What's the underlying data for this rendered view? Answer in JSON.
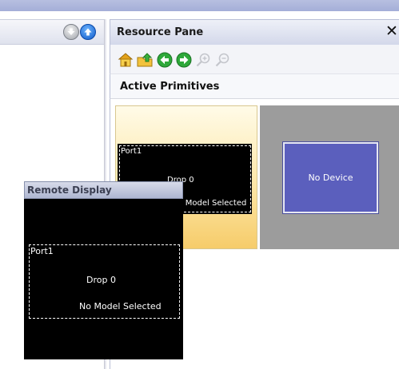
{
  "resource_pane": {
    "title": "Resource Pane",
    "close_glyph": "✕",
    "subtitle": "Active Primitives",
    "toolbar_icons": [
      "home-folder-icon",
      "up-folder-icon",
      "back-arrow-icon",
      "forward-arrow-icon",
      "zoom-in-icon",
      "zoom-out-icon"
    ],
    "tiles": [
      {
        "port_label": "Port1",
        "drop_label": "Drop 0",
        "model_label": "No Model Selected",
        "selected": true
      },
      {
        "device_label": "No Device",
        "selected": false
      }
    ]
  },
  "left_panel": {
    "icons": [
      "scroll-down-icon",
      "scroll-up-icon"
    ]
  },
  "remote_display": {
    "title": "Remote Display",
    "port_label": "Port1",
    "drop_label": "Drop 0",
    "model_label": "No Model Selected"
  },
  "colors": {
    "title_bar": "#d3d8ea",
    "tile_selected": "#f6cc6a",
    "no_device": "#5b5fbd",
    "tile_gray": "#9c9c9c"
  }
}
